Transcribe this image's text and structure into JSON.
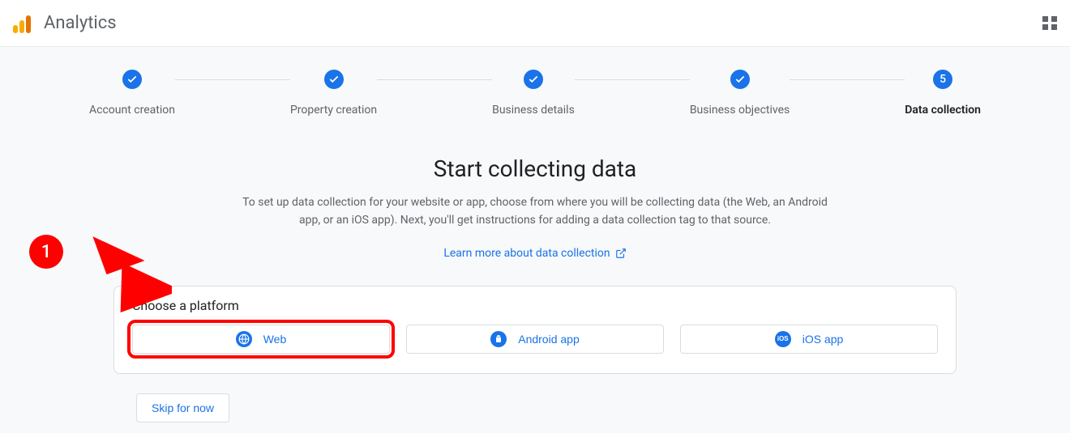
{
  "header": {
    "brand": "Analytics"
  },
  "stepper": {
    "steps": [
      {
        "label": "Account creation",
        "done": true
      },
      {
        "label": "Property creation",
        "done": true
      },
      {
        "label": "Business details",
        "done": true
      },
      {
        "label": "Business objectives",
        "done": true
      },
      {
        "label": "Data collection",
        "done": false,
        "number": "5",
        "active": true
      }
    ]
  },
  "content": {
    "title": "Start collecting data",
    "subtitle": "To set up data collection for your website or app, choose from where you will be collecting data (the Web, an Android app, or an iOS app). Next, you'll get instructions for adding a data collection tag to that source.",
    "learn_more": "Learn more about data collection"
  },
  "panel": {
    "title": "Choose a platform",
    "platforms": [
      {
        "label": "Web",
        "icon": "globe-icon",
        "highlighted": true
      },
      {
        "label": "Android app",
        "icon": "android-icon",
        "highlighted": false
      },
      {
        "label": "iOS app",
        "icon": "ios-icon",
        "highlighted": false
      }
    ]
  },
  "skip_label": "Skip for now",
  "annotation": {
    "number": "1"
  }
}
